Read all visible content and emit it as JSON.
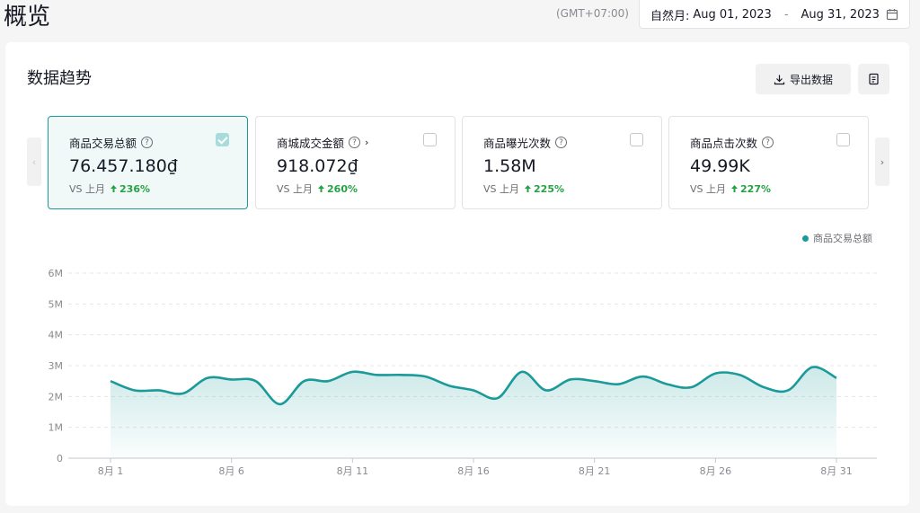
{
  "header": {
    "title": "概览",
    "timezone": "(GMT+07:00)",
    "date_label": "自然月:",
    "date_start": "Aug 01, 2023",
    "date_sep": "-",
    "date_end": "Aug 31, 2023",
    "calendar_icon": "calendar-icon"
  },
  "section": {
    "title": "数据趋势",
    "export_label": "导出数据",
    "export_icon": "download-icon",
    "doc_icon": "document-icon"
  },
  "metrics": [
    {
      "name": "商品交易总额",
      "value": "76.457.180₫",
      "compare": "VS 上月",
      "change": "236%",
      "checked": true,
      "has_chevron": false
    },
    {
      "name": "商城成交金额",
      "value": "918.072₫",
      "compare": "VS 上月",
      "change": "260%",
      "checked": false,
      "has_chevron": true,
      "chevron": "›"
    },
    {
      "name": "商品曝光次数",
      "value": "1.58M",
      "compare": "VS 上月",
      "change": "225%",
      "checked": false,
      "has_chevron": false
    },
    {
      "name": "商品点击次数",
      "value": "49.99K",
      "compare": "VS 上月",
      "change": "227%",
      "checked": false,
      "has_chevron": false
    }
  ],
  "nav": {
    "prev": "‹",
    "next": "›"
  },
  "help_glyph": "?",
  "accent_color": "#1a9a98",
  "positive_color": "#25a244",
  "chart_data": {
    "type": "area",
    "series": [
      {
        "name": "商品交易总额",
        "color": "#1a9a98",
        "values": [
          2.5,
          2.2,
          2.2,
          2.1,
          2.6,
          2.55,
          2.5,
          1.75,
          2.5,
          2.5,
          2.8,
          2.7,
          2.7,
          2.65,
          2.35,
          2.2,
          1.95,
          2.8,
          2.2,
          2.55,
          2.5,
          2.4,
          2.65,
          2.4,
          2.3,
          2.75,
          2.7,
          2.3,
          2.2,
          2.95,
          2.6
        ]
      }
    ],
    "x_tick_labels": [
      "8月 1",
      "8月 6",
      "8月 11",
      "8月 16",
      "8月 21",
      "8月 26",
      "8月 31"
    ],
    "x_tick_days": [
      1,
      6,
      11,
      16,
      21,
      26,
      31
    ],
    "y_tick_labels": [
      "0",
      "1M",
      "2M",
      "3M",
      "4M",
      "5M",
      "6M"
    ],
    "ylim": [
      0,
      6
    ],
    "grid": true,
    "legend_position": "top-right"
  }
}
